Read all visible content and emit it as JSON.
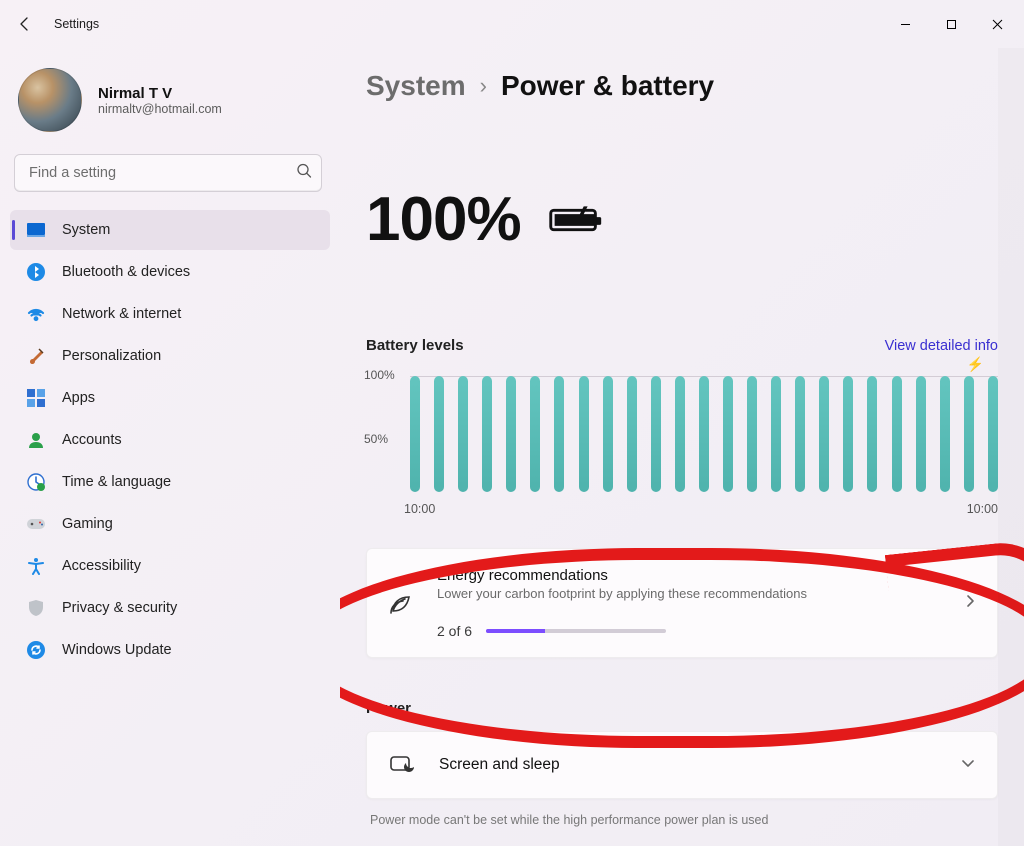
{
  "titlebar": {
    "app_name": "Settings"
  },
  "user": {
    "name": "Nirmal T V",
    "email": "nirmaltv@hotmail.com"
  },
  "search": {
    "placeholder": "Find a setting"
  },
  "sidebar": {
    "items": [
      {
        "label": "System"
      },
      {
        "label": "Bluetooth & devices"
      },
      {
        "label": "Network & internet"
      },
      {
        "label": "Personalization"
      },
      {
        "label": "Apps"
      },
      {
        "label": "Accounts"
      },
      {
        "label": "Time & language"
      },
      {
        "label": "Gaming"
      },
      {
        "label": "Accessibility"
      },
      {
        "label": "Privacy & security"
      },
      {
        "label": "Windows Update"
      }
    ]
  },
  "breadcrumb": {
    "root": "System",
    "leaf": "Power & battery"
  },
  "battery": {
    "percent": "100%"
  },
  "levels": {
    "header": "Battery levels",
    "link": "View detailed info",
    "y100": "100%",
    "y50": "50%",
    "x_start": "10:00",
    "x_end": "10:00"
  },
  "energy": {
    "title": "Energy recommendations",
    "sub": "Lower your carbon footprint by applying these recommendations",
    "count": "2 of 6"
  },
  "power": {
    "header": "Power",
    "sleep": "Screen and sleep",
    "note": "Power mode can't be set while the high performance power plan is used"
  },
  "chart_data": {
    "type": "bar",
    "title": "Battery levels",
    "ylabel": "",
    "xlabel": "",
    "ylim": [
      0,
      100
    ],
    "x_start": "10:00",
    "x_end": "10:00",
    "values": [
      100,
      100,
      100,
      100,
      100,
      100,
      100,
      100,
      100,
      100,
      100,
      100,
      100,
      100,
      100,
      100,
      100,
      100,
      100,
      100,
      100,
      100,
      100,
      100,
      100
    ],
    "charging": true
  }
}
